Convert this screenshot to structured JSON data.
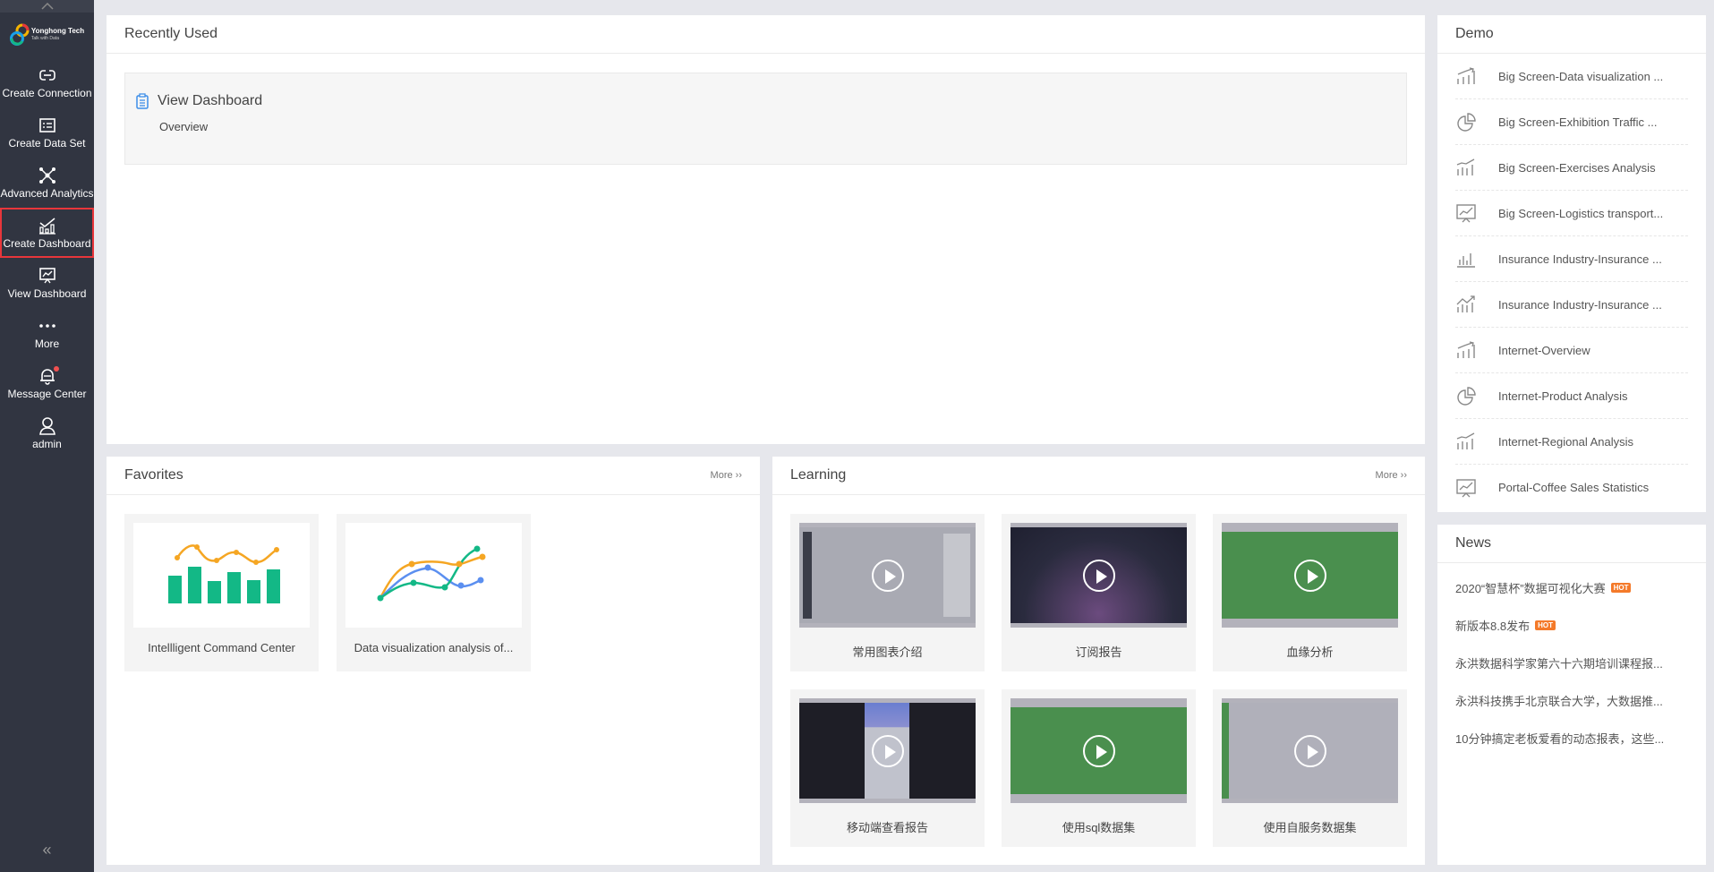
{
  "sidebar": {
    "logo": {
      "name": "Yonghong Tech",
      "tagline": "Talk with Data"
    },
    "items": [
      {
        "label": "Create Connection",
        "icon": "link-icon"
      },
      {
        "label": "Create Data Set",
        "icon": "dataset-icon"
      },
      {
        "label": "Advanced Analytics",
        "icon": "network-icon"
      },
      {
        "label": "Create Dashboard",
        "icon": "chart-icon",
        "selected": true
      },
      {
        "label": "View Dashboard",
        "icon": "presentation-icon"
      },
      {
        "label": "More",
        "icon": "more-dots-icon"
      },
      {
        "label": "Message Center",
        "icon": "bell-icon",
        "badge": true
      },
      {
        "label": "admin",
        "icon": "user-icon"
      }
    ],
    "collapse": "«"
  },
  "recent": {
    "title": "Recently Used",
    "items": [
      {
        "title": "View Dashboard",
        "subtitle": "Overview"
      }
    ]
  },
  "favorites": {
    "title": "Favorites",
    "more": "More",
    "items": [
      {
        "label": "Intellligent Command Center"
      },
      {
        "label": "Data visualization analysis of..."
      }
    ]
  },
  "learning": {
    "title": "Learning",
    "more": "More",
    "items": [
      {
        "label": "常用图表介绍",
        "theme": "gray"
      },
      {
        "label": "订阅报告",
        "theme": "dark"
      },
      {
        "label": "血缘分析",
        "theme": "green"
      },
      {
        "label": "移动端查看报告",
        "theme": "mobile"
      },
      {
        "label": "使用sql数据集",
        "theme": "green"
      },
      {
        "label": "使用自服务数据集",
        "theme": "light"
      }
    ]
  },
  "demo": {
    "title": "Demo",
    "items": [
      {
        "label": "Big Screen-Data visualization ...",
        "icon": "bar-trend-icon"
      },
      {
        "label": "Big Screen-Exhibition Traffic ...",
        "icon": "pie-chart-icon"
      },
      {
        "label": "Big Screen-Exercises Analysis",
        "icon": "bar-line-icon"
      },
      {
        "label": "Big Screen-Logistics transport...",
        "icon": "monitor-chart-icon"
      },
      {
        "label": "Insurance Industry-Insurance ...",
        "icon": "bar-chart-icon"
      },
      {
        "label": "Insurance Industry-Insurance ...",
        "icon": "bar-arrow-icon"
      },
      {
        "label": "Internet-Overview",
        "icon": "bar-trend-icon"
      },
      {
        "label": "Internet-Product Analysis",
        "icon": "pie-chart-icon"
      },
      {
        "label": "Internet-Regional Analysis",
        "icon": "bar-line-icon"
      },
      {
        "label": "Portal-Coffee Sales Statistics",
        "icon": "monitor-chart-icon"
      }
    ]
  },
  "news": {
    "title": "News",
    "hot_label": "HOT",
    "items": [
      {
        "text": "2020“智慧杯”数据可视化大赛",
        "hot": true
      },
      {
        "text": "新版本8.8发布",
        "hot": true
      },
      {
        "text": "永洪数据科学家第六十六期培训课程报...",
        "hot": false
      },
      {
        "text": "永洪科技携手北京联合大学，大数据推...",
        "hot": false
      },
      {
        "text": "10分钟搞定老板爱看的动态报表，这些...",
        "hot": false
      }
    ]
  },
  "colors": {
    "sidebar": "#313541",
    "selected_outline": "#e8363b",
    "hot": "#f47a2a",
    "accent_green": "#13b886",
    "accent_orange": "#f5a623",
    "accent_blue": "#5b8ff0"
  }
}
